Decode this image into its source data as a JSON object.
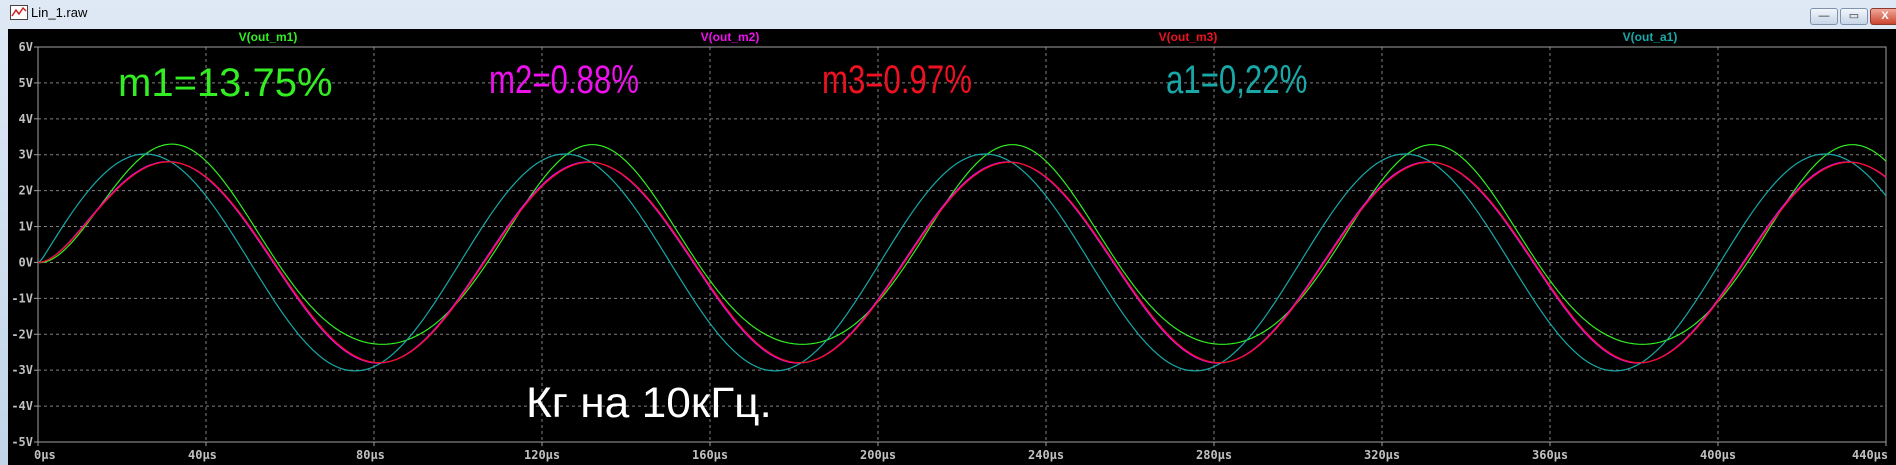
{
  "window": {
    "title": "Lin_1.raw",
    "buttons": {
      "minimize": "—",
      "restore": "▭",
      "close": "X"
    }
  },
  "annotations": [
    {
      "text": "m1=13.75%",
      "color": "#33ee22"
    },
    {
      "text": "m2=0.88%",
      "color": "#ee11ee"
    },
    {
      "text": "m3=0.97%",
      "color": "#ee1122"
    },
    {
      "text": "a1=0,22%",
      "color": "#18a8a8"
    },
    {
      "text": "Кг на 10кГц.",
      "color": "#ffffff"
    }
  ],
  "chart_data": {
    "type": "line",
    "title": "",
    "xlabel": "",
    "ylabel": "",
    "xlim": [
      0,
      440
    ],
    "x_unit": "µs",
    "ylim": [
      -5,
      6
    ],
    "y_unit": "V",
    "grid": true,
    "x_ticks": [
      "0µs",
      "40µs",
      "80µs",
      "120µs",
      "160µs",
      "200µs",
      "240µs",
      "280µs",
      "320µs",
      "360µs",
      "400µs",
      "440µs"
    ],
    "y_ticks": [
      "6V",
      "5V",
      "4V",
      "3V",
      "2V",
      "1V",
      "0V",
      "-1V",
      "-2V",
      "-3V",
      "-4V",
      "-5V"
    ],
    "frequency_khz": 10,
    "series": [
      {
        "name": "V(out_m1)",
        "color": "#33ee22",
        "amplitude": 2.78,
        "delay_us": 7.0,
        "second_harmonic": 0.25,
        "peak": 3.28,
        "trough": -2.28
      },
      {
        "name": "V(out_m2)",
        "color": "#ee11ee",
        "amplitude": 2.8,
        "delay_us": 6.0,
        "second_harmonic": 0.0,
        "peak": 2.8,
        "trough": -2.8
      },
      {
        "name": "V(out_m3)",
        "color": "#ee1122",
        "amplitude": 2.79,
        "delay_us": 6.3,
        "second_harmonic": 0.0,
        "peak": 2.79,
        "trough": -2.79
      },
      {
        "name": "V(out_a1)",
        "color": "#18a8a8",
        "amplitude": 3.02,
        "delay_us": 0.5,
        "second_harmonic": 0.0,
        "peak": 3.0,
        "trough": -3.05
      }
    ]
  }
}
